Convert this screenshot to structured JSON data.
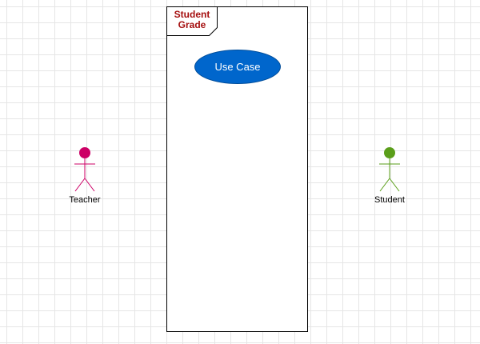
{
  "diagram": {
    "system": {
      "title": "Student\nGrade",
      "title_color": "#a50f0f"
    },
    "use_case": {
      "label": "Use Case",
      "fill_color": "#0066cc",
      "text_color": "#ffffff"
    },
    "actors": {
      "teacher": {
        "label": "Teacher",
        "color": "#cc0066"
      },
      "student": {
        "label": "Student",
        "color": "#5a9e1a"
      }
    }
  }
}
